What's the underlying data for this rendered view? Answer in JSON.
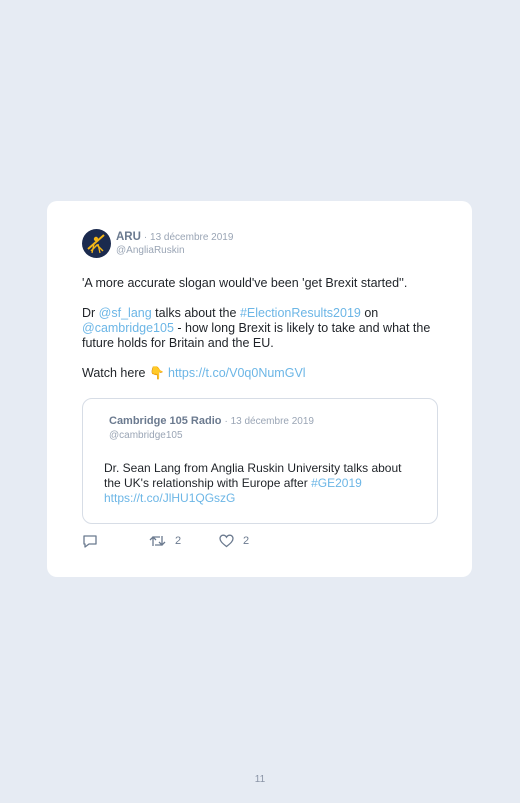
{
  "tweet": {
    "author_name": "ARU",
    "date": "· 13 décembre 2019",
    "handle": "@AngliaRuskin",
    "line1": "'A more accurate slogan would've been 'get Brexit started''.",
    "p2_prefix": "Dr ",
    "mention1": "@sf_lang",
    "p2_mid": " talks about the ",
    "hashtag1": "#ElectionResults2019",
    "p2_on": " on",
    "mention2": "@cambridge105",
    "p2_rest": " - how long Brexit is likely to take and what the future holds for Britain and the EU.",
    "watch_prefix": "Watch here ",
    "emoji": "👇",
    "link": "https://t.co/V0q0NumGVl"
  },
  "quoted": {
    "author_name": "Cambridge 105 Radio",
    "date": "· 13 décembre 2019",
    "handle": "@cambridge105",
    "text": "Dr. Sean Lang from Anglia Ruskin University talks about the UK's relationship with Europe after ",
    "hashtag": "#GE2019",
    "link": "https://t.co/JlHU1QGszG"
  },
  "actions": {
    "retweet_count": "2",
    "like_count": "2"
  },
  "page_number": "11",
  "colors": {
    "background": "#e6ebf3",
    "link": "#6cb6e6",
    "avatar_bg": "#1b2a4e",
    "avatar_accent": "#f2b417"
  },
  "icons": [
    "reply-icon",
    "retweet-icon",
    "like-icon",
    "aru-logo-icon"
  ]
}
